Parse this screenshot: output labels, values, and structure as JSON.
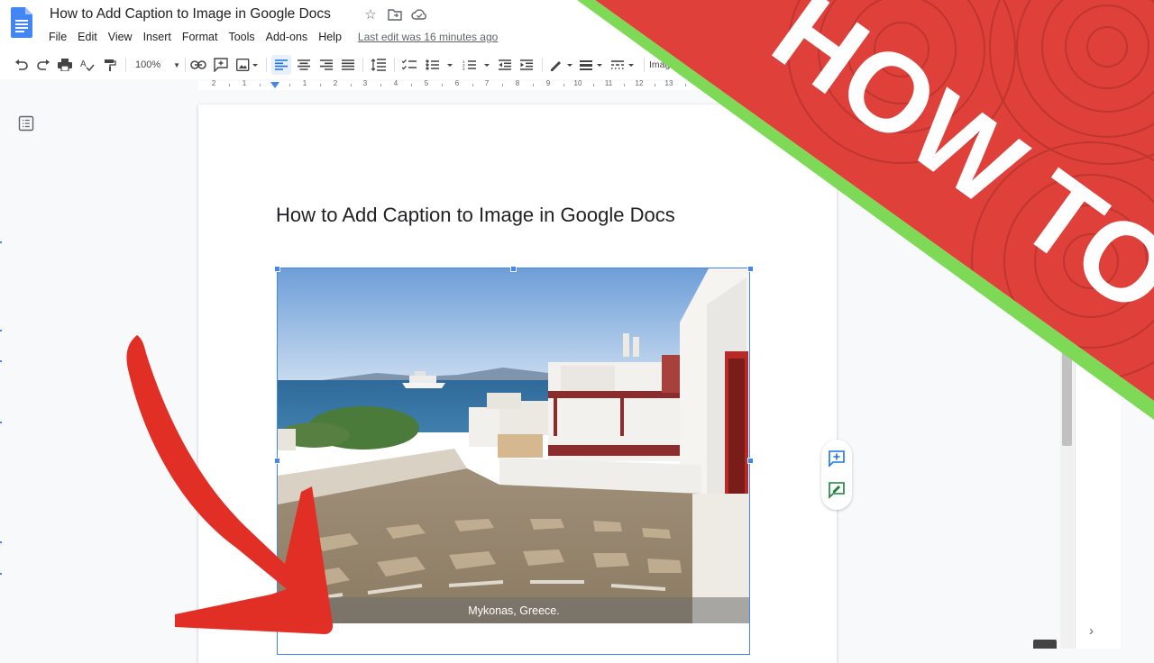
{
  "title_bar": {
    "doc_title": "How to Add Caption to Image in Google Docs",
    "menu": [
      "File",
      "Edit",
      "View",
      "Insert",
      "Format",
      "Tools",
      "Add-ons",
      "Help"
    ],
    "last_edit": "Last edit was 16 minutes ago"
  },
  "toolbar": {
    "zoom": "100%",
    "image_options": "Imag"
  },
  "ruler": {
    "numbers": [
      "2",
      "1",
      "1",
      "2",
      "3",
      "4",
      "5",
      "6",
      "7",
      "8",
      "9",
      "10",
      "11",
      "12",
      "13"
    ]
  },
  "document": {
    "heading": "How to Add Caption to Image in Google Docs",
    "caption": "Mykonas, Greece."
  },
  "overlay": {
    "text": "HOW TO"
  },
  "colors": {
    "accent": "#4285f4",
    "banner_red": "#e0403a",
    "banner_green": "#7ed957",
    "arrow_red": "#e12f25"
  },
  "icons": {
    "docs_logo": "google-docs-logo",
    "star": "star-icon",
    "move": "move-to-folder-icon",
    "cloud": "cloud-saved-icon",
    "outline": "document-outline-icon",
    "add_comment": "add-comment-icon",
    "suggest_edit": "suggest-edit-icon",
    "chevron": "chevron-right-icon"
  }
}
